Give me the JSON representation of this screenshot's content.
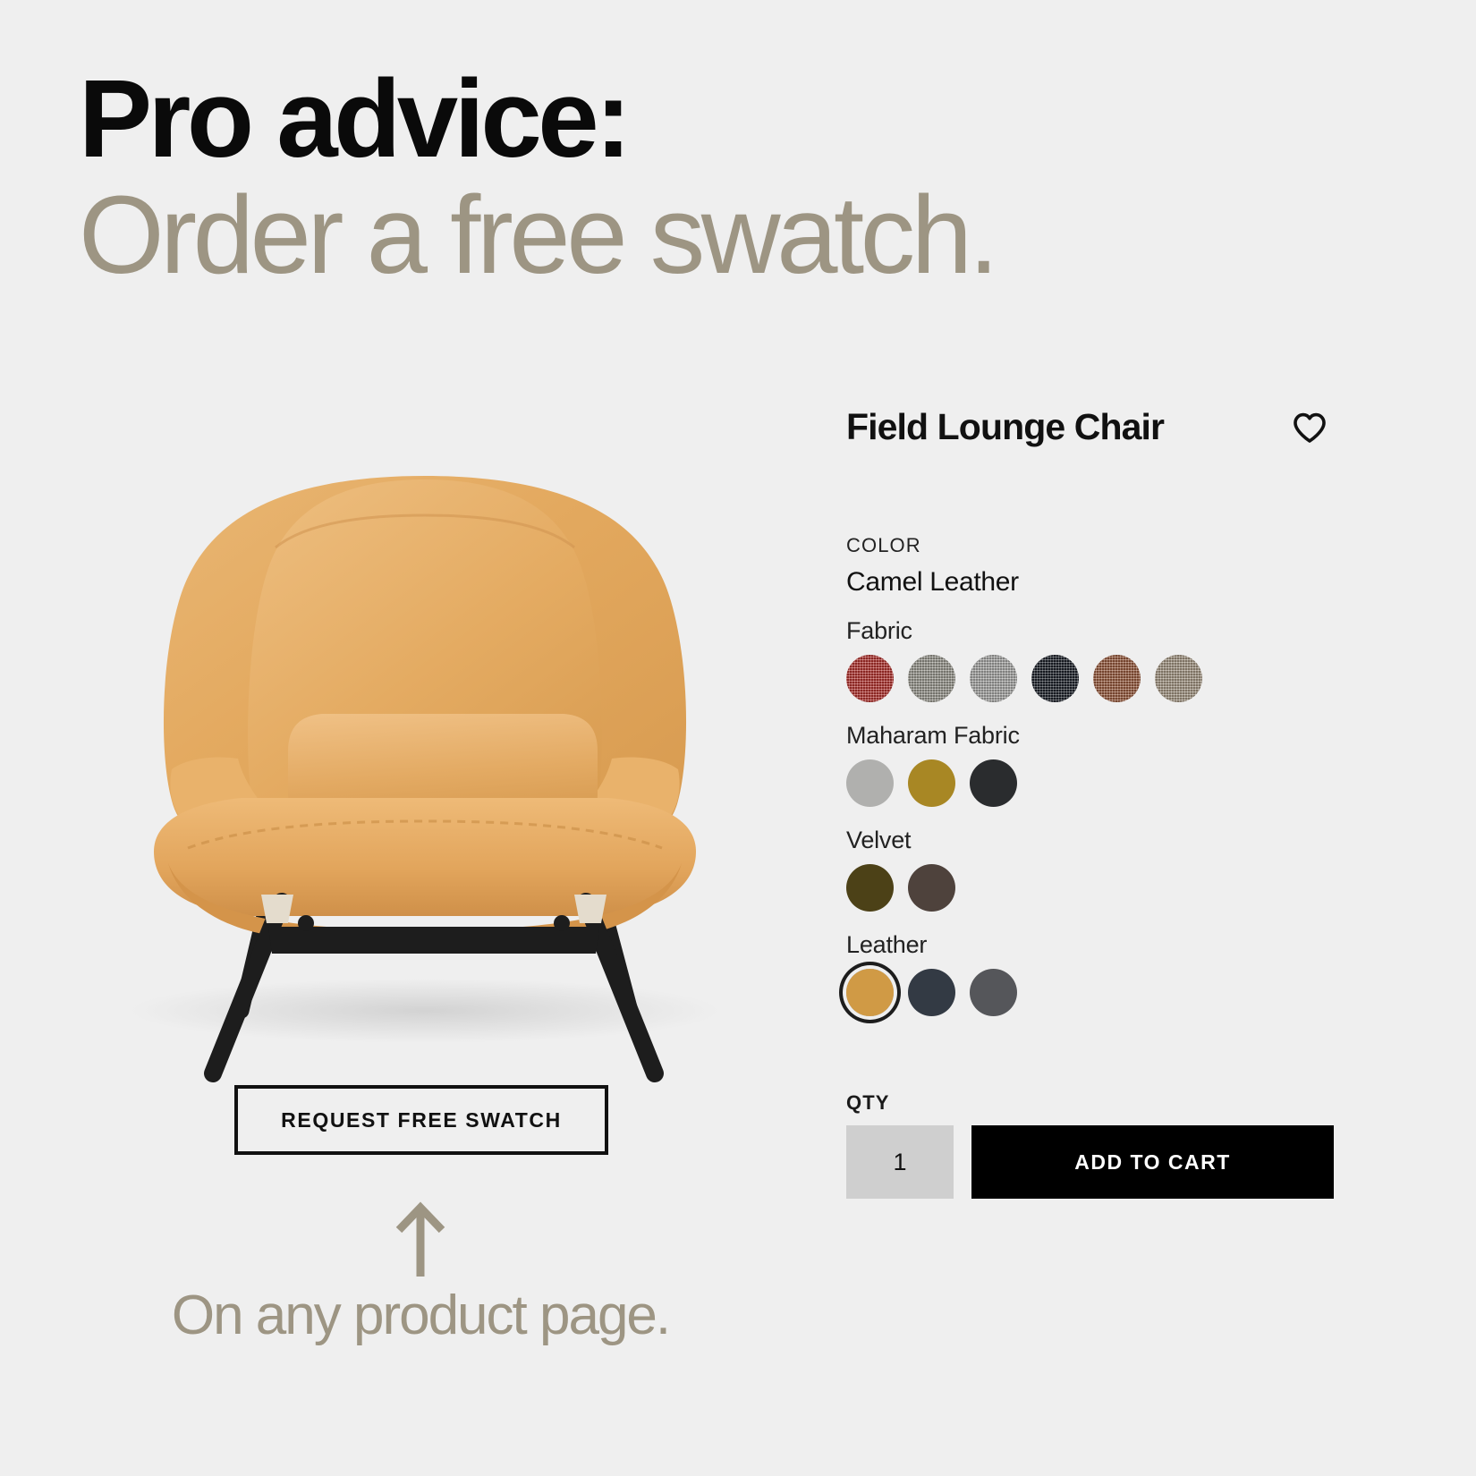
{
  "headline": {
    "line1": "Pro advice:",
    "line2": "Order a free swatch.",
    "line1_color": "#0a0a0a",
    "line2_color": "#9d9583"
  },
  "background_color": "#efefef",
  "product_image": {
    "alt": "Field Lounge Chair in camel leather with black metal legs",
    "leather_color": "#e2a55c",
    "leg_color": "#1d1d1d"
  },
  "swatch_request": {
    "button_label": "REQUEST FREE SWATCH",
    "arrow_icon": "arrow-up-icon",
    "caption": "On any product page.",
    "caption_color": "#9d9583"
  },
  "product": {
    "title": "Field Lounge Chair",
    "favorite_icon": "heart-icon",
    "color_label": "COLOR",
    "color_value": "Camel Leather",
    "groups": [
      {
        "label": "Fabric",
        "swatches": [
          {
            "name": "red-fabric",
            "color": "#b7332f",
            "texture": "woven",
            "selected": false
          },
          {
            "name": "gray-tweed-fabric",
            "color": "#9a988f",
            "texture": "woven",
            "selected": false
          },
          {
            "name": "light-gray-fabric",
            "color": "#a9a9a6",
            "texture": "woven",
            "selected": false
          },
          {
            "name": "black-fabric",
            "color": "#1d222a",
            "texture": "woven",
            "selected": false
          },
          {
            "name": "rust-fabric",
            "color": "#9a5a3c",
            "texture": "woven",
            "selected": false
          },
          {
            "name": "taupe-fabric",
            "color": "#a59784",
            "texture": "woven",
            "selected": false
          }
        ]
      },
      {
        "label": "Maharam Fabric",
        "swatches": [
          {
            "name": "maharam-gray",
            "color": "#b0b0ae",
            "texture": "plain",
            "selected": false
          },
          {
            "name": "maharam-mustard",
            "color": "#a88724",
            "texture": "plain",
            "selected": false
          },
          {
            "name": "maharam-black",
            "color": "#2a2c2e",
            "texture": "plain",
            "selected": false
          }
        ]
      },
      {
        "label": "Velvet",
        "swatches": [
          {
            "name": "velvet-olive",
            "color": "#4c4117",
            "texture": "plain",
            "selected": false
          },
          {
            "name": "velvet-brown",
            "color": "#4e423c",
            "texture": "plain",
            "selected": false
          }
        ]
      },
      {
        "label": "Leather",
        "swatches": [
          {
            "name": "leather-camel",
            "color": "#d09a45",
            "texture": "plain",
            "selected": true
          },
          {
            "name": "leather-navy",
            "color": "#333a44",
            "texture": "plain",
            "selected": false
          },
          {
            "name": "leather-dark-gray",
            "color": "#55565a",
            "texture": "plain",
            "selected": false
          }
        ]
      }
    ],
    "qty_label": "QTY",
    "qty_value": "1",
    "add_to_cart_label": "ADD TO CART",
    "accent_black": "#000000",
    "qty_field_bg": "#cfcfcf"
  }
}
